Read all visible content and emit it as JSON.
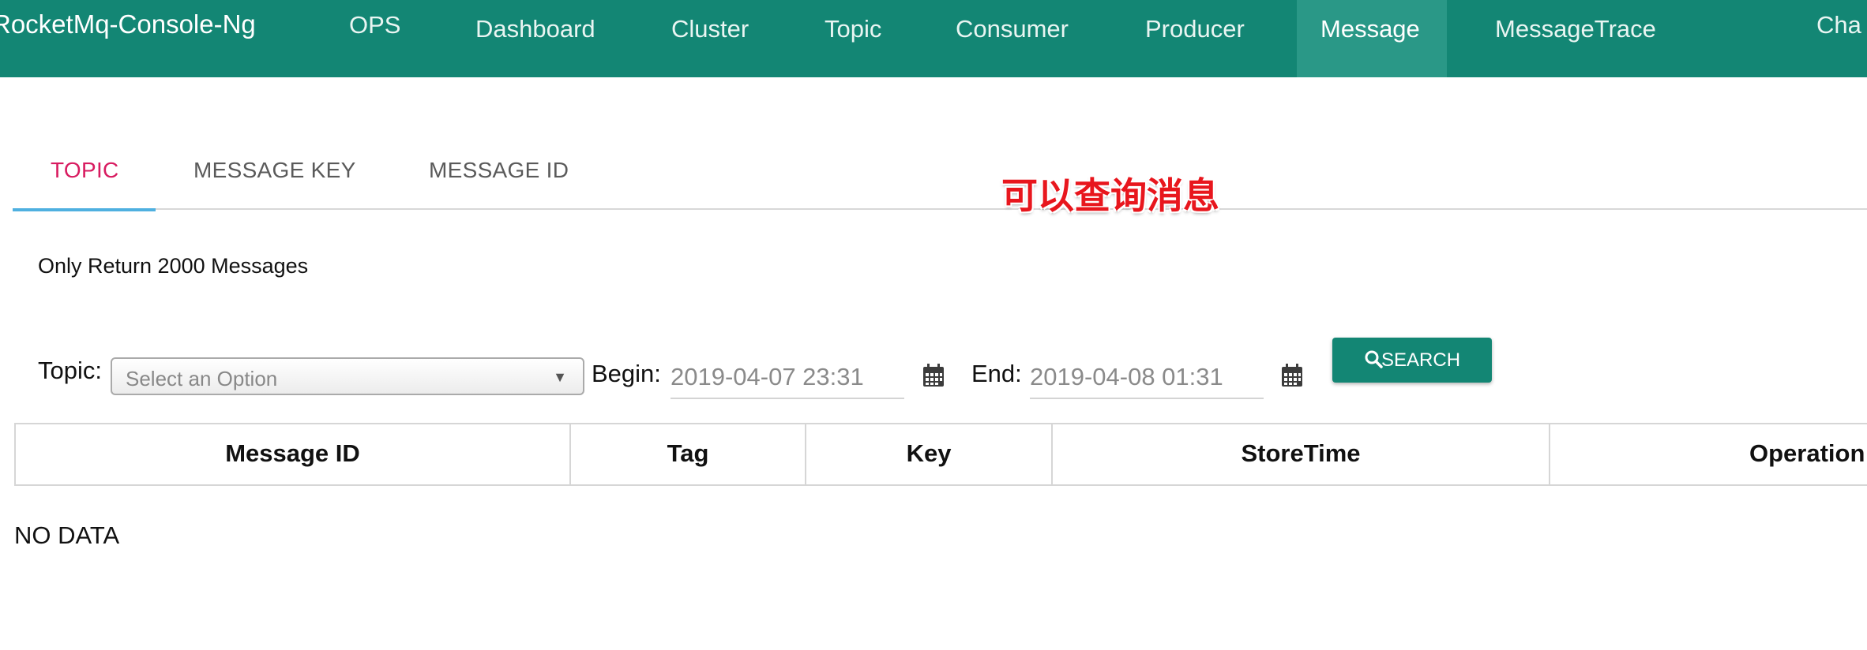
{
  "navbar": {
    "brand": "RocketMq-Console-Ng",
    "items": [
      {
        "label": "OPS"
      },
      {
        "label": "Dashboard"
      },
      {
        "label": "Cluster"
      },
      {
        "label": "Topic"
      },
      {
        "label": "Consumer"
      },
      {
        "label": "Producer"
      },
      {
        "label": "Message"
      },
      {
        "label": "MessageTrace"
      },
      {
        "label": "Cha"
      }
    ],
    "active": "Message",
    "colors": {
      "background": "#138674",
      "active_background": "#2a9887"
    }
  },
  "tabs": {
    "items": [
      {
        "label": "TOPIC"
      },
      {
        "label": "MESSAGE KEY"
      },
      {
        "label": "MESSAGE ID"
      }
    ],
    "active": "TOPIC",
    "colors": {
      "active_text": "#d81b60",
      "indicator": "#4fb0e0"
    }
  },
  "annotation": "可以查询消息",
  "notice": "Only Return 2000 Messages",
  "filters": {
    "topic_label": "Topic:",
    "topic_placeholder": "Select an Option",
    "begin_label": "Begin:",
    "begin_value": "2019-04-07 23:31",
    "end_label": "End:",
    "end_value": "2019-04-08 01:31",
    "calendar_icon": "calendar-icon",
    "search_icon": "search-icon",
    "search_label": "SEARCH"
  },
  "table": {
    "columns": [
      {
        "label": "Message ID"
      },
      {
        "label": "Tag"
      },
      {
        "label": "Key"
      },
      {
        "label": "StoreTime"
      },
      {
        "label": "Operation"
      }
    ],
    "empty_text": "NO DATA"
  }
}
